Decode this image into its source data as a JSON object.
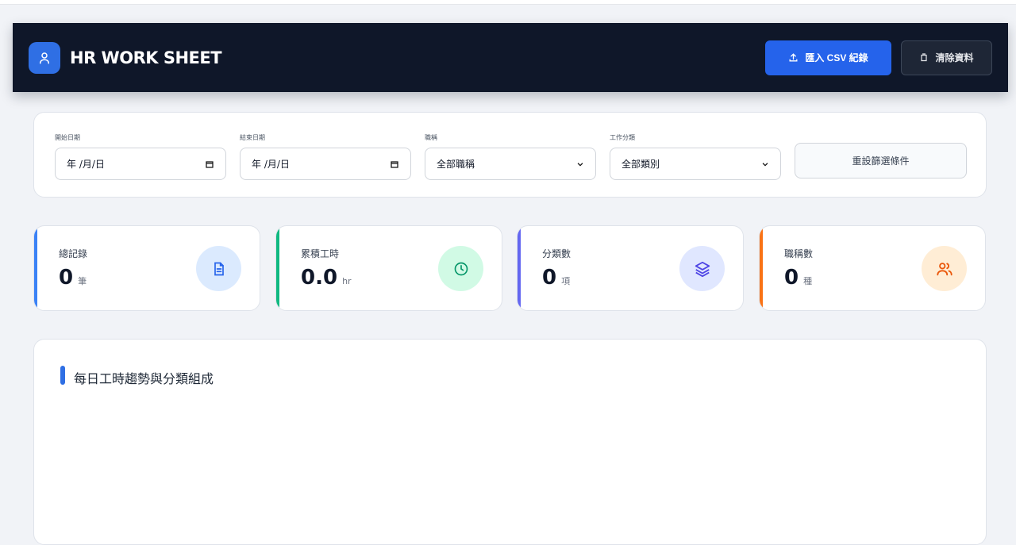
{
  "header": {
    "title": "HR WORK SHEET",
    "import_label": "匯入 CSV 紀錄",
    "clear_label": "清除資料",
    "brand_color": "#2563eb"
  },
  "filters": {
    "start_date": {
      "label": "開始日期",
      "value": "年 /月/日"
    },
    "end_date": {
      "label": "結束日期",
      "value": "年 /月/日"
    },
    "position": {
      "label": "職稱",
      "value": "全部職稱"
    },
    "work_category": {
      "label": "工作分類",
      "value": "全部類別"
    },
    "reset_label": "重設篩選條件"
  },
  "stats": [
    {
      "label": "總記錄",
      "value": "0",
      "unit": "筆",
      "color": "#3b82f6",
      "icon": "file-text-icon"
    },
    {
      "label": "累積工時",
      "value": "0.0",
      "unit": "hr",
      "color": "#10b981",
      "icon": "clock-icon"
    },
    {
      "label": "分類數",
      "value": "0",
      "unit": "項",
      "color": "#6366f1",
      "icon": "layers-icon"
    },
    {
      "label": "職稱數",
      "value": "0",
      "unit": "種",
      "color": "#f97316",
      "icon": "users-icon"
    }
  ],
  "chart": {
    "title": "每日工時趨勢與分類組成"
  }
}
